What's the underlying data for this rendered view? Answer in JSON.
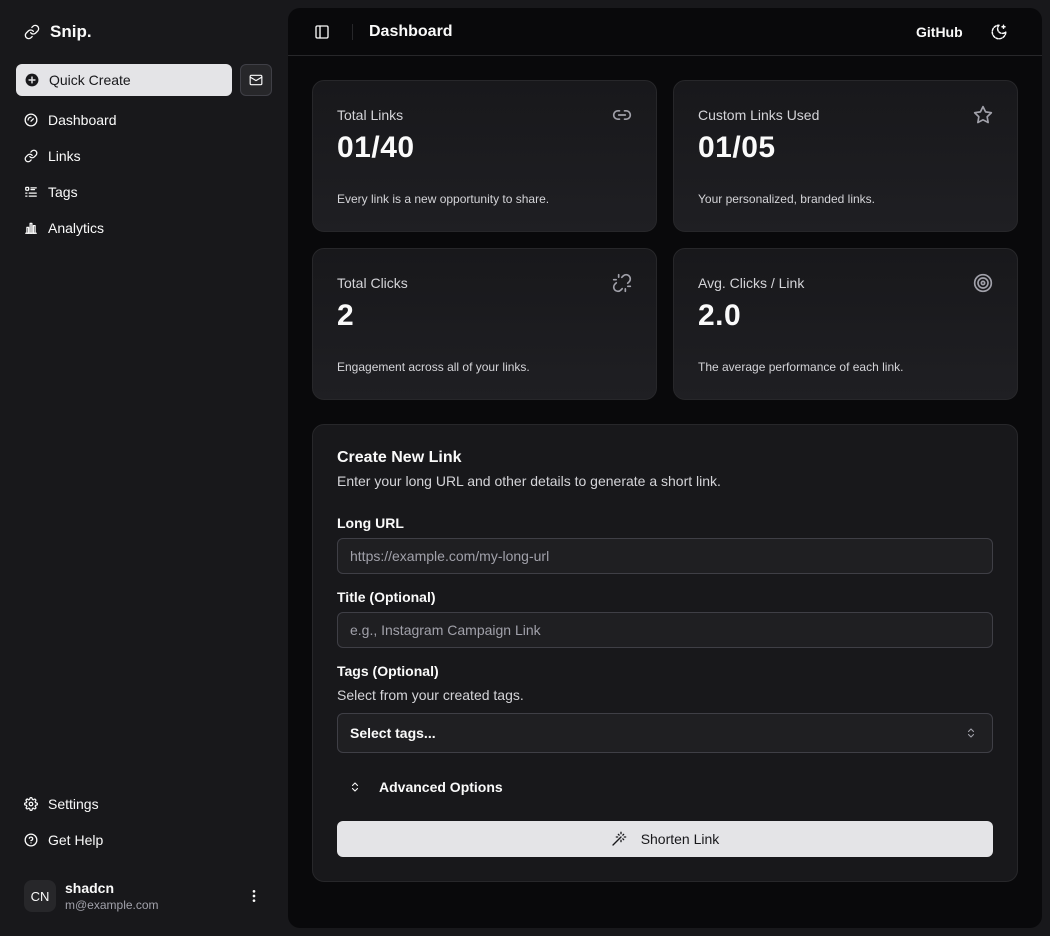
{
  "sidebar": {
    "brand": "Snip.",
    "quick_create": "Quick Create",
    "nav_items": [
      {
        "label": "Dashboard",
        "icon": "gauge-icon"
      },
      {
        "label": "Links",
        "icon": "link-icon"
      },
      {
        "label": "Tags",
        "icon": "list-icon"
      },
      {
        "label": "Analytics",
        "icon": "bar-chart-icon"
      }
    ],
    "bottom_items": [
      {
        "label": "Settings",
        "icon": "gear-icon"
      },
      {
        "label": "Get Help",
        "icon": "help-circle-icon"
      }
    ],
    "user": {
      "initials": "CN",
      "name": "shadcn",
      "email": "m@example.com"
    }
  },
  "header": {
    "title": "Dashboard",
    "github": "GitHub"
  },
  "stats": [
    {
      "label": "Total Links",
      "value": "01/40",
      "description": "Every link is a new opportunity to share.",
      "icon": "link-icon"
    },
    {
      "label": "Custom Links Used",
      "value": "01/05",
      "description": "Your personalized, branded links.",
      "icon": "star-icon"
    },
    {
      "label": "Total Clicks",
      "value": "2",
      "description": "Engagement across all of your links.",
      "icon": "unlink-icon"
    },
    {
      "label": "Avg. Clicks / Link",
      "value": "2.0",
      "description": "The average performance of each link.",
      "icon": "target-icon"
    }
  ],
  "form": {
    "title": "Create New Link",
    "subtitle": "Enter your long URL and other details to generate a short link.",
    "long_url_label": "Long URL",
    "long_url_placeholder": "https://example.com/my-long-url",
    "title_label": "Title (Optional)",
    "title_placeholder": "e.g., Instagram Campaign Link",
    "tags_label": "Tags (Optional)",
    "tags_help": "Select from your created tags.",
    "tags_select": "Select tags...",
    "advanced_label": "Advanced Options",
    "submit_label": "Shorten Link"
  },
  "colors": {
    "sidebar_bg": "#18181b",
    "main_bg": "#09090b",
    "card_border": "#27272a",
    "primary_button": "#e4e4e7"
  }
}
